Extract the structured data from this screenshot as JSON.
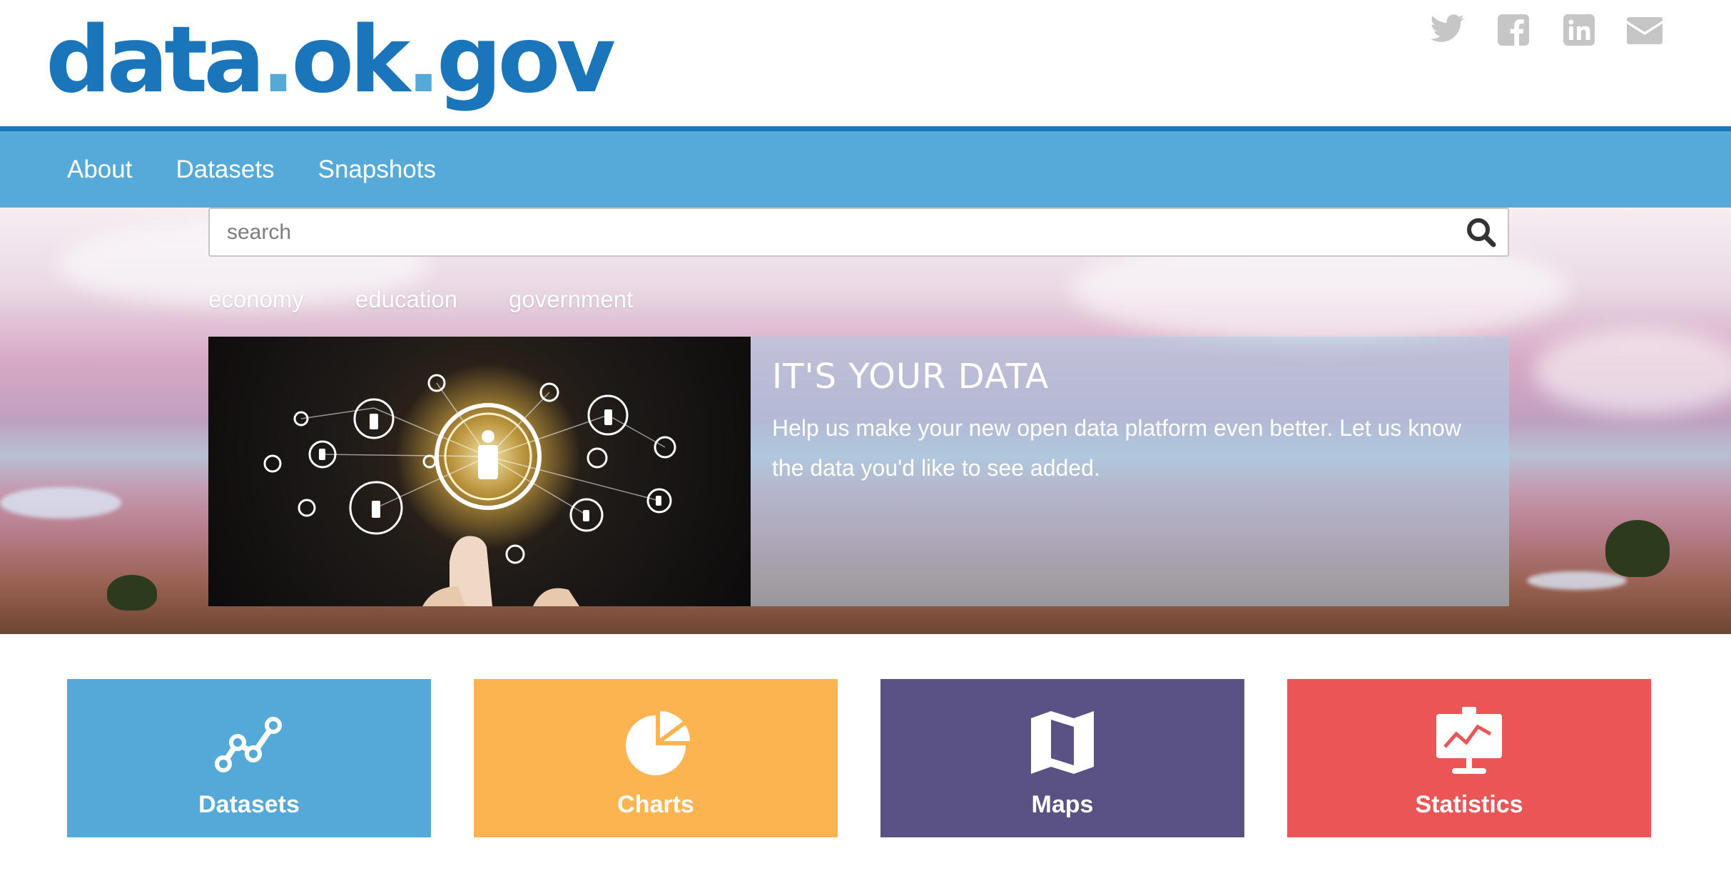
{
  "header": {
    "logo": {
      "part1": "data",
      "dot1": ".",
      "part2": "ok",
      "dot2": ".",
      "part3": "gov"
    },
    "social": [
      "twitter-icon",
      "facebook-icon",
      "linkedin-icon",
      "email-icon"
    ]
  },
  "nav": {
    "items": [
      {
        "label": "About"
      },
      {
        "label": "Datasets"
      },
      {
        "label": "Snapshots"
      }
    ]
  },
  "search": {
    "placeholder": "search",
    "value": ""
  },
  "topics": [
    {
      "label": "economy"
    },
    {
      "label": "education"
    },
    {
      "label": "government"
    }
  ],
  "feature": {
    "title": "IT'S YOUR DATA",
    "text": "Help us make your new open data platform even better. Let us know the data you'd like to see added."
  },
  "tiles": [
    {
      "label": "Datasets",
      "icon": "line-graph-icon",
      "color": "#55a9d9"
    },
    {
      "label": "Charts",
      "icon": "pie-chart-icon",
      "color": "#fcb450"
    },
    {
      "label": "Maps",
      "icon": "map-icon",
      "color": "#5a5185"
    },
    {
      "label": "Statistics",
      "icon": "presentation-board-icon",
      "color": "#ec5556"
    }
  ],
  "colors": {
    "brand_blue": "#1b75bb",
    "nav_blue": "#56aad9",
    "logo_dot": "#55a9d9"
  }
}
